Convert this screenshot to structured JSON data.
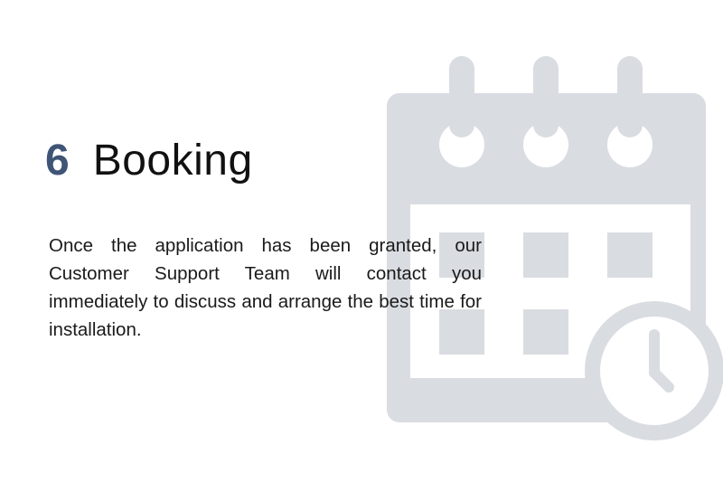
{
  "step": {
    "number": "6",
    "title": "Booking"
  },
  "body": {
    "text": "Once the application has been granted, our Customer Support Team will contact you immediately to discuss and arrange the best time for installation."
  },
  "graphic": {
    "icon": "calendar-clock-icon"
  },
  "colors": {
    "number": "#3f5575",
    "icon": "#d9dce1",
    "background": "#ffffff"
  }
}
